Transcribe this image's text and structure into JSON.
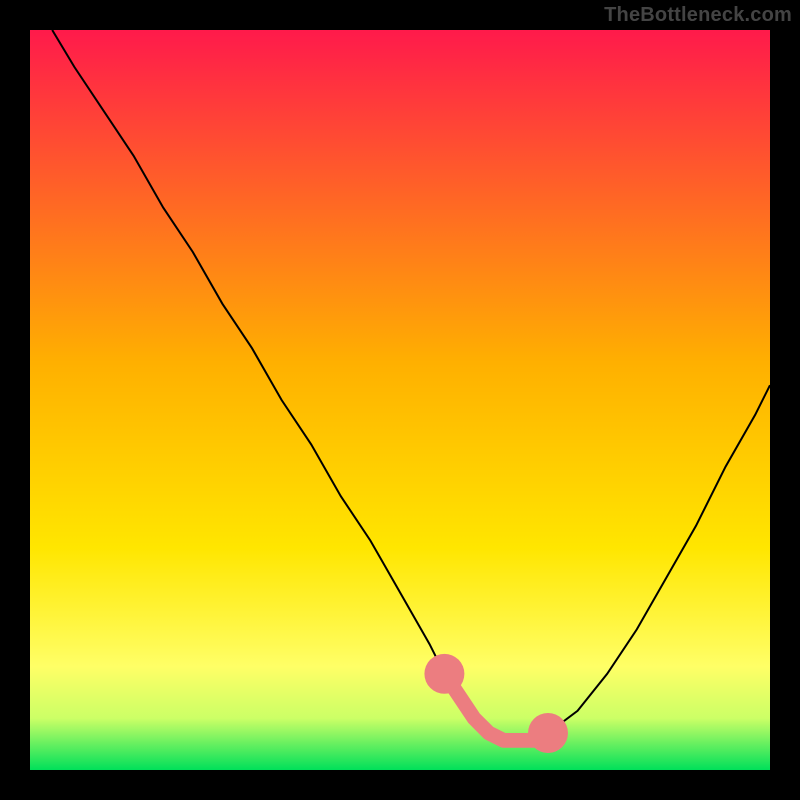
{
  "watermark": "TheBottleneck.com",
  "chart_data": {
    "type": "line",
    "title": "",
    "xlabel": "",
    "ylabel": "",
    "xlim": [
      0,
      100
    ],
    "ylim": [
      0,
      100
    ],
    "background_gradient": {
      "stops": [
        {
          "offset": 0,
          "color": "#ff1a4b"
        },
        {
          "offset": 45,
          "color": "#ffb000"
        },
        {
          "offset": 70,
          "color": "#ffe600"
        },
        {
          "offset": 86,
          "color": "#ffff66"
        },
        {
          "offset": 93,
          "color": "#ccff66"
        },
        {
          "offset": 100,
          "color": "#00e05a"
        }
      ]
    },
    "series": [
      {
        "name": "bottleneck-curve",
        "color": "#000000",
        "width": 2,
        "x": [
          3,
          6,
          10,
          14,
          18,
          22,
          26,
          30,
          34,
          38,
          42,
          46,
          50,
          54,
          56,
          58,
          60,
          62,
          64,
          66,
          68,
          70,
          74,
          78,
          82,
          86,
          90,
          94,
          98,
          100
        ],
        "y": [
          100,
          95,
          89,
          83,
          76,
          70,
          63,
          57,
          50,
          44,
          37,
          31,
          24,
          17,
          13,
          10,
          7,
          5,
          4,
          4,
          4,
          5,
          8,
          13,
          19,
          26,
          33,
          41,
          48,
          52
        ]
      }
    ],
    "highlight_strip": {
      "name": "optimal-range",
      "color": "#ec7d80",
      "cap_color": "#ec7d80",
      "x": [
        56,
        58,
        60,
        62,
        64,
        66,
        68,
        70
      ],
      "y": [
        13,
        10,
        7,
        5,
        4,
        4,
        4,
        5
      ],
      "strip_thickness": 2.0,
      "cap_radius": 2.7
    }
  }
}
